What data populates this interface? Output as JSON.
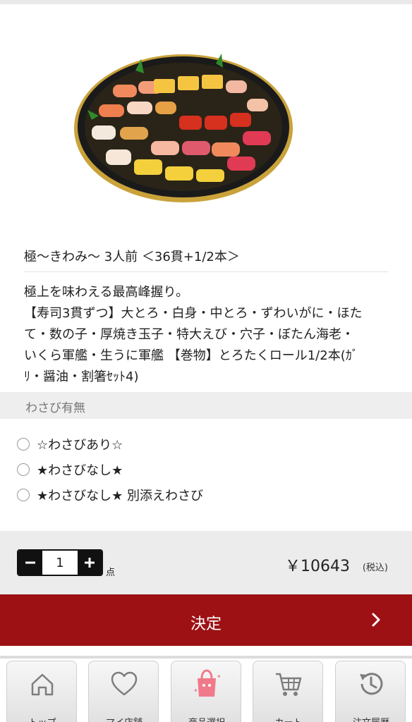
{
  "product": {
    "name": "極〜きわみ〜 3人前 ＜36貫+1/2本＞",
    "description_lines": [
      "極上を味わえる最高峰握り。",
      "【寿司3貫ずつ】大とろ・白身・中とろ・ずわいがに・ほた",
      "て・数の子・厚焼き玉子・特大えび・穴子・ぼたん海老・",
      "いくら軍艦・生うに軍艦 【巻物】とろたくロール1/2本(ｶﾞ",
      "ﾘ・醤油・割箸ｾｯﾄ4)"
    ]
  },
  "options": {
    "header": "わさび有無",
    "items": [
      {
        "label": "☆わさびあり☆"
      },
      {
        "label": "★わさびなし★"
      },
      {
        "label": "★わさびなし★ 別添えわさび"
      }
    ]
  },
  "quantity": {
    "value": "1",
    "unit": "点",
    "minus_icon": "minus-icon",
    "plus_icon": "plus-icon"
  },
  "price": {
    "amount": "￥10643",
    "tax_note": "(税込)"
  },
  "decide_button": {
    "label": "決定"
  },
  "tabbar": {
    "items": [
      {
        "label": "トップ",
        "icon": "home-icon"
      },
      {
        "label": "マイ店舗",
        "icon": "heart-icon"
      },
      {
        "label": "商品選択",
        "icon": "shopping-bag-icon"
      },
      {
        "label": "カート",
        "icon": "cart-icon"
      },
      {
        "label": "注文履歴",
        "icon": "history-icon"
      }
    ]
  },
  "colors": {
    "accent": "#9d1115",
    "stepper": "#111111"
  }
}
